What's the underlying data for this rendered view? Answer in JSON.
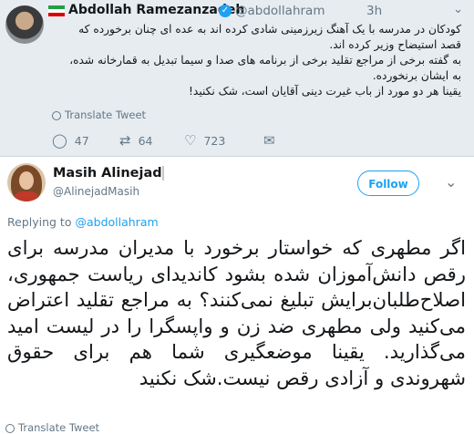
{
  "colors": {
    "link_blue": "#1da1f2",
    "muted_gray": "#657786",
    "card_bg": "#e6ecf0"
  },
  "quoted_tweet": {
    "author_name": "Abdollah Ramezanzadeh",
    "handle": "@abdollahram",
    "time": "3h",
    "verified_icon": "verified-badge-icon",
    "flag_icon": "iran-flag-icon",
    "body_lines": [
      "کودکان در مدرسه با یک آهنگ زیرزمینی  شادی کرده اند به عده ای چنان برخورده که قصد استیضاح وزیر کرده اند.",
      "به گفته برخی از مراجع تقلید برخی از برنامه های صدا و سیما تبدیل به قمارخانه شده، به ایشان برنخورده.",
      "یقینا هر دو مورد از باب غیرت دینی آقایان است، شک نکنید!"
    ],
    "translate_label": "Translate Tweet",
    "reply_count": "47",
    "retweet_count": "64",
    "like_count": "723"
  },
  "main_tweet": {
    "author_name": "Masih Alinejad",
    "handle": "@AlinejadMasih",
    "follow_label": "Follow",
    "replying_prefix": "Replying to",
    "replying_handle": "@abdollahram",
    "body": "اگر مطهری که خواستار برخورد با مدیران مدرسه برای رقص دانش‌آموزان شده بشود کاندیدای ریاست جمهوری، اصلاح‌طلبان‌برایش تبلیغ نمی‌کنند؟ به مراجع تقلید اعتراض می‌کنید ولی مطهری ضد زن و واپسگرا را در لیست امید می‌گذارید. یقینا موضعگیری شما هم برای حقوق شهروندی و آزادی رقص نیست.شک نکنید",
    "translate_label": "Translate Tweet"
  }
}
